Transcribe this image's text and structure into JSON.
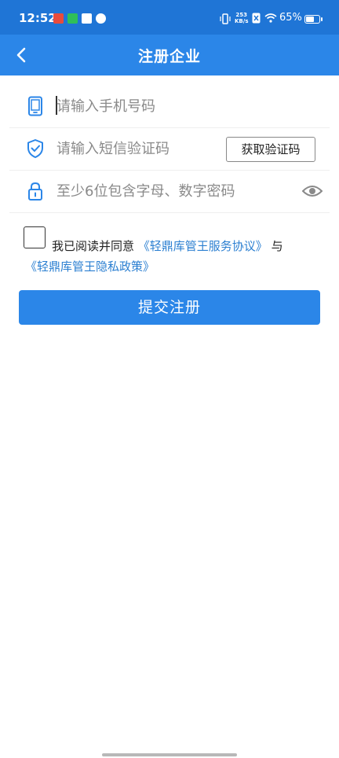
{
  "status_bar": {
    "time": "12:52",
    "speed_value": "253",
    "speed_unit": "KB/s",
    "battery": "65%",
    "battery_fraction": 0.65
  },
  "nav": {
    "title": "注册企业"
  },
  "form": {
    "phone_placeholder": "请输入手机号码",
    "code_placeholder": "请输入短信验证码",
    "code_button": "获取验证码",
    "password_placeholder": "至少6位包含字母、数字密码"
  },
  "agreement": {
    "prefix": "我已阅读并同意",
    "service_link": "《轻鼎库管王服务协议》",
    "joiner": "与",
    "privacy_link": "《轻鼎库管王隐私政策》"
  },
  "submit_label": "提交注册",
  "colors": {
    "primary": "#2b86e8",
    "status_bar": "#1f75d6",
    "link": "#2b7fd1"
  }
}
